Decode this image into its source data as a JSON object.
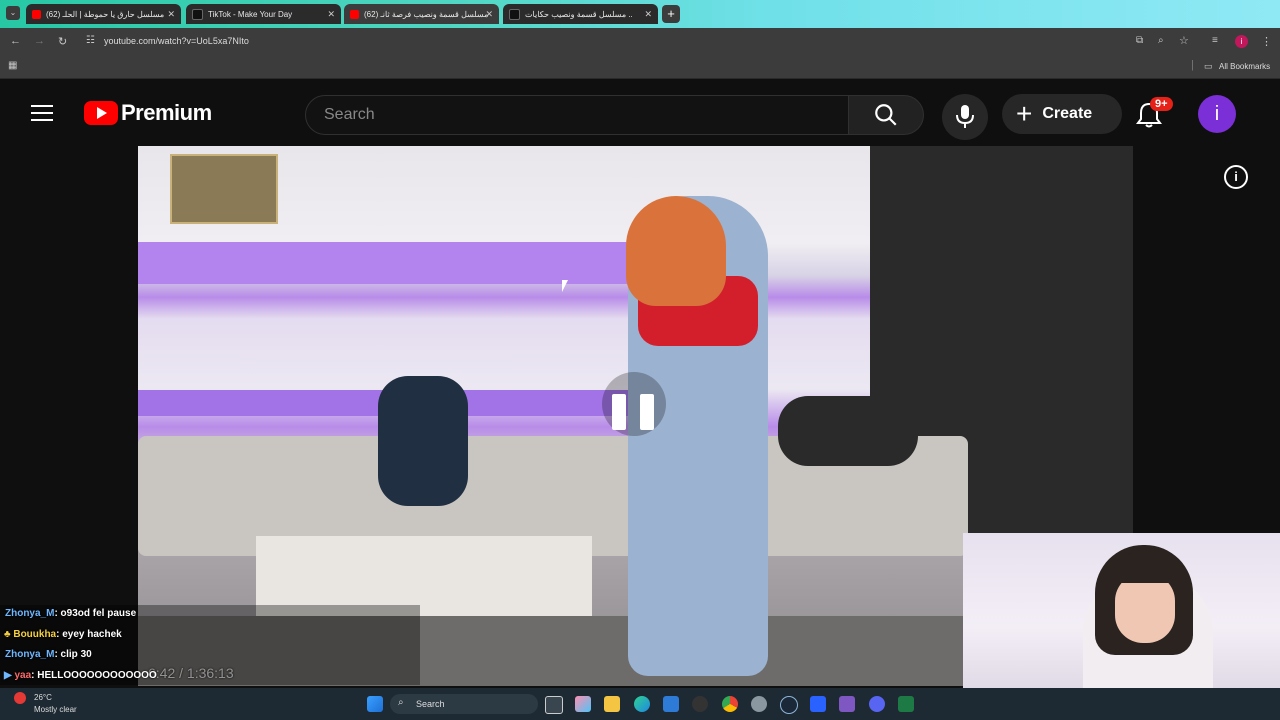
{
  "tabs": [
    {
      "title": "مسلسل حارق يا حموطة | الحلـ (62)",
      "favicon_color": "#ff0000",
      "active": false
    },
    {
      "title": "TikTok - Make Your Day",
      "favicon_color": "#111111",
      "active": false
    },
    {
      "title": "مسلسل قسمة ونصيب فرصة ثانـ (62)",
      "favicon_color": "#ff0000",
      "active": true
    },
    {
      "title": "مسلسل قسمة ونصيب حكايات ..",
      "favicon_color": "#111111",
      "active": false
    }
  ],
  "browser": {
    "url": "youtube.com/watch?v=UoL5xa7NIto",
    "all_bookmarks": "All Bookmarks",
    "profile_letter": "i"
  },
  "youtube": {
    "logo_text": "Premium",
    "search_placeholder": "Search",
    "create_label": "Create",
    "notification_badge": "9+",
    "avatar_letter": "i"
  },
  "player": {
    "time": "6:42 / 1:36:13",
    "state": "paused"
  },
  "chat": [
    {
      "user": "Zhonya_M",
      "message": ": o93od fel pause",
      "user_color": "#6fb7ff"
    },
    {
      "user": "Bouukha",
      "message": ": eyey hachek",
      "user_color": "#f5d142"
    },
    {
      "user": "Zhonya_M",
      "message": ": clip 30",
      "user_color": "#6fb7ff"
    },
    {
      "user": "yaa",
      "message": ": HELLOOOOOOOOOOOO",
      "user_color": "#ff6a6a"
    }
  ],
  "taskbar": {
    "weather_temp": "26°C",
    "weather_desc": "Mostly clear",
    "search_label": "Search"
  }
}
